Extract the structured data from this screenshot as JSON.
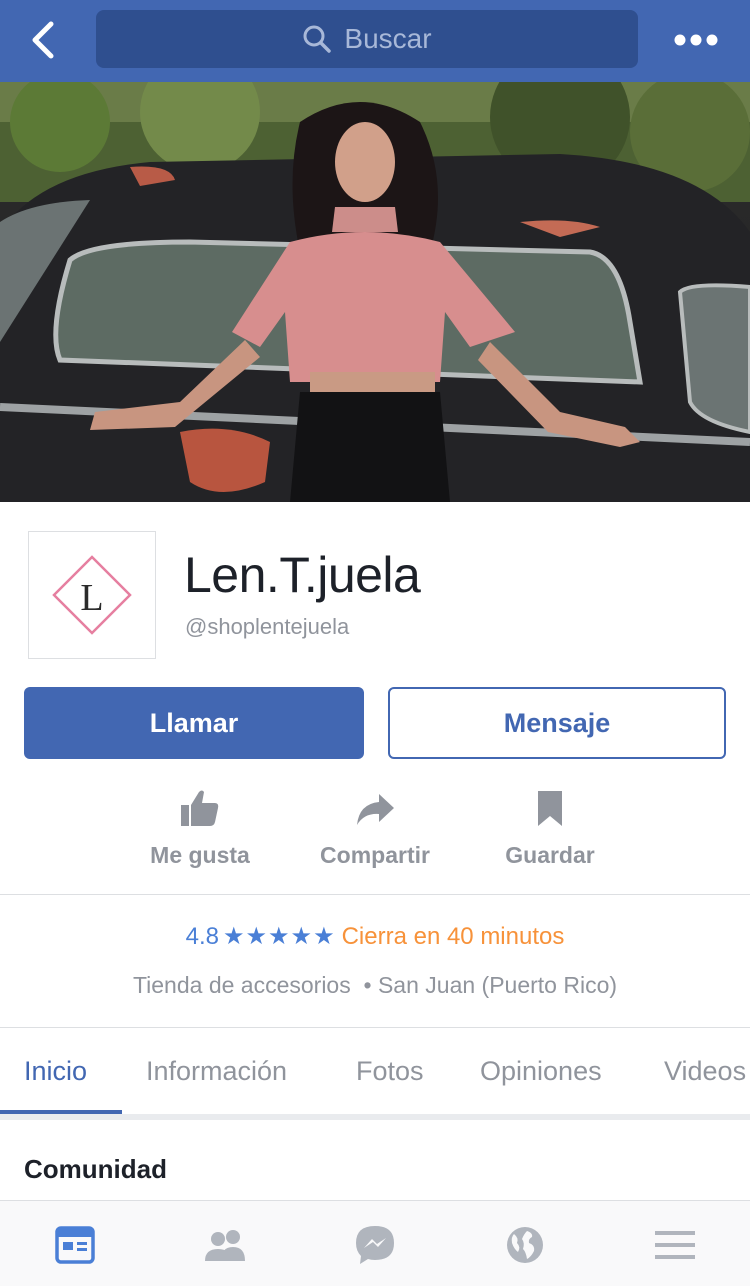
{
  "topbar": {
    "search_placeholder": "Buscar",
    "back_icon": "chevron-left-icon",
    "more_icon": "more-horizontal-icon"
  },
  "profile": {
    "name": "Len.T.juela",
    "handle": "@shoplentejuela",
    "logo_letter": "L"
  },
  "buttons": {
    "call": "Llamar",
    "message": "Mensaje"
  },
  "actions": [
    {
      "label": "Me gusta",
      "icon": "thumbs-up-icon"
    },
    {
      "label": "Compartir",
      "icon": "share-icon"
    },
    {
      "label": "Guardar",
      "icon": "bookmark-icon"
    }
  ],
  "info": {
    "rating": "4.8",
    "stars": "★★★★★",
    "rating_value": 4.8,
    "hours": "Cierra en 40 minutos",
    "category": "Tienda de accesorios",
    "location": "San Juan (Puerto Rico)"
  },
  "tabs": [
    {
      "label": "Inicio",
      "active": true
    },
    {
      "label": "Información",
      "active": false
    },
    {
      "label": "Fotos",
      "active": false
    },
    {
      "label": "Opiniones",
      "active": false
    },
    {
      "label": "Videos",
      "active": false
    }
  ],
  "section": {
    "title": "Comunidad"
  },
  "bottom_nav": [
    {
      "icon": "news-feed-icon",
      "active": true
    },
    {
      "icon": "friends-icon",
      "active": false
    },
    {
      "icon": "messenger-icon",
      "active": false
    },
    {
      "icon": "globe-icon",
      "active": false
    },
    {
      "icon": "menu-icon",
      "active": false
    }
  ],
  "colors": {
    "brand": "#4267b2",
    "rating": "#4a7fd6",
    "hours": "#f7923a",
    "muted": "#90949c",
    "logo_pink": "#e67fa0"
  }
}
